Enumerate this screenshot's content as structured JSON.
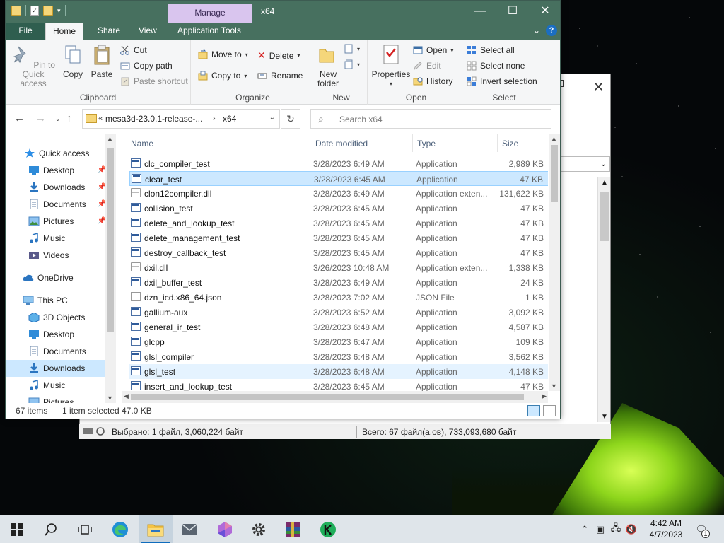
{
  "window": {
    "title": "x64",
    "contextual_tab": "Manage"
  },
  "tabs": [
    "File",
    "Home",
    "Share",
    "View",
    "Application Tools"
  ],
  "ribbon": {
    "clipboard": {
      "label": "Clipboard",
      "pin": "Pin to Quick access",
      "copy": "Copy",
      "paste": "Paste",
      "cut": "Cut",
      "copy_path": "Copy path",
      "paste_shortcut": "Paste shortcut"
    },
    "organize": {
      "label": "Organize",
      "move_to": "Move to",
      "copy_to": "Copy to",
      "delete": "Delete",
      "rename": "Rename"
    },
    "new": {
      "label": "New",
      "new_folder": "New folder"
    },
    "open": {
      "label": "Open",
      "properties": "Properties",
      "open": "Open",
      "edit": "Edit",
      "history": "History"
    },
    "select": {
      "label": "Select",
      "select_all": "Select all",
      "select_none": "Select none",
      "invert": "Invert selection"
    }
  },
  "address": {
    "crumb_parent": "mesa3d-23.0.1-release-...",
    "crumb_current": "x64",
    "overflow": "«",
    "search_placeholder": "Search x64"
  },
  "nav": {
    "quick_access": "Quick access",
    "items": [
      {
        "label": "Desktop",
        "icon": "desktop-icon"
      },
      {
        "label": "Downloads",
        "icon": "downloads-icon"
      },
      {
        "label": "Documents",
        "icon": "documents-icon"
      },
      {
        "label": "Pictures",
        "icon": "pictures-icon"
      },
      {
        "label": "Music",
        "icon": "music-icon"
      },
      {
        "label": "Videos",
        "icon": "videos-icon"
      }
    ],
    "onedrive": "OneDrive",
    "this_pc": "This PC",
    "pc_items": [
      {
        "label": "3D Objects"
      },
      {
        "label": "Desktop"
      },
      {
        "label": "Documents"
      },
      {
        "label": "Downloads"
      },
      {
        "label": "Music"
      },
      {
        "label": "Pictures"
      }
    ]
  },
  "columns": {
    "name": "Name",
    "date": "Date modified",
    "type": "Type",
    "size": "Size"
  },
  "files": [
    {
      "name": "clc_compiler_test",
      "date": "3/28/2023 6:49 AM",
      "type": "Application",
      "size": "2,989 KB",
      "icon": "exe"
    },
    {
      "name": "clear_test",
      "date": "3/28/2023 6:45 AM",
      "type": "Application",
      "size": "47 KB",
      "icon": "exe"
    },
    {
      "name": "clon12compiler.dll",
      "date": "3/28/2023 6:49 AM",
      "type": "Application exten...",
      "size": "131,622 KB",
      "icon": "dll"
    },
    {
      "name": "collision_test",
      "date": "3/28/2023 6:45 AM",
      "type": "Application",
      "size": "47 KB",
      "icon": "exe"
    },
    {
      "name": "delete_and_lookup_test",
      "date": "3/28/2023 6:45 AM",
      "type": "Application",
      "size": "47 KB",
      "icon": "exe"
    },
    {
      "name": "delete_management_test",
      "date": "3/28/2023 6:45 AM",
      "type": "Application",
      "size": "47 KB",
      "icon": "exe"
    },
    {
      "name": "destroy_callback_test",
      "date": "3/28/2023 6:45 AM",
      "type": "Application",
      "size": "47 KB",
      "icon": "exe"
    },
    {
      "name": "dxil.dll",
      "date": "3/26/2023 10:48 AM",
      "type": "Application exten...",
      "size": "1,338 KB",
      "icon": "dll"
    },
    {
      "name": "dxil_buffer_test",
      "date": "3/28/2023 6:49 AM",
      "type": "Application",
      "size": "24 KB",
      "icon": "exe"
    },
    {
      "name": "dzn_icd.x86_64.json",
      "date": "3/28/2023 7:02 AM",
      "type": "JSON File",
      "size": "1 KB",
      "icon": "doc"
    },
    {
      "name": "gallium-aux",
      "date": "3/28/2023 6:52 AM",
      "type": "Application",
      "size": "3,092 KB",
      "icon": "exe"
    },
    {
      "name": "general_ir_test",
      "date": "3/28/2023 6:48 AM",
      "type": "Application",
      "size": "4,587 KB",
      "icon": "exe"
    },
    {
      "name": "glcpp",
      "date": "3/28/2023 6:47 AM",
      "type": "Application",
      "size": "109 KB",
      "icon": "exe"
    },
    {
      "name": "glsl_compiler",
      "date": "3/28/2023 6:48 AM",
      "type": "Application",
      "size": "3,562 KB",
      "icon": "exe"
    },
    {
      "name": "glsl_test",
      "date": "3/28/2023 6:48 AM",
      "type": "Application",
      "size": "4,148 KB",
      "icon": "exe"
    },
    {
      "name": "insert_and_lookup_test",
      "date": "3/28/2023 6:45 AM",
      "type": "Application",
      "size": "47 KB",
      "icon": "exe"
    }
  ],
  "selected_row": 1,
  "hover_row": 14,
  "status": {
    "count": "67 items",
    "selected": "1 item selected",
    "size": "47.0 KB"
  },
  "bg_status": {
    "left": "Выбрано: 1 файл, 3,060,224 байт",
    "right": "Всего: 67 файл(а,ов), 733,093,680 байт"
  },
  "taskbar": {
    "time": "4:42 AM",
    "date": "4/7/2023",
    "notification_count": "1",
    "apps": [
      "start-icon",
      "search-icon",
      "task-view-icon",
      "edge-icon",
      "file-explorer-icon",
      "mail-icon",
      "app-icon",
      "settings-icon",
      "winrar-icon",
      "kaspersky-icon"
    ]
  },
  "colors": {
    "titlebar": "#47705f",
    "manage_tab": "#d9c5ee",
    "selection": "#cce8ff",
    "header_text": "#4c607a"
  }
}
